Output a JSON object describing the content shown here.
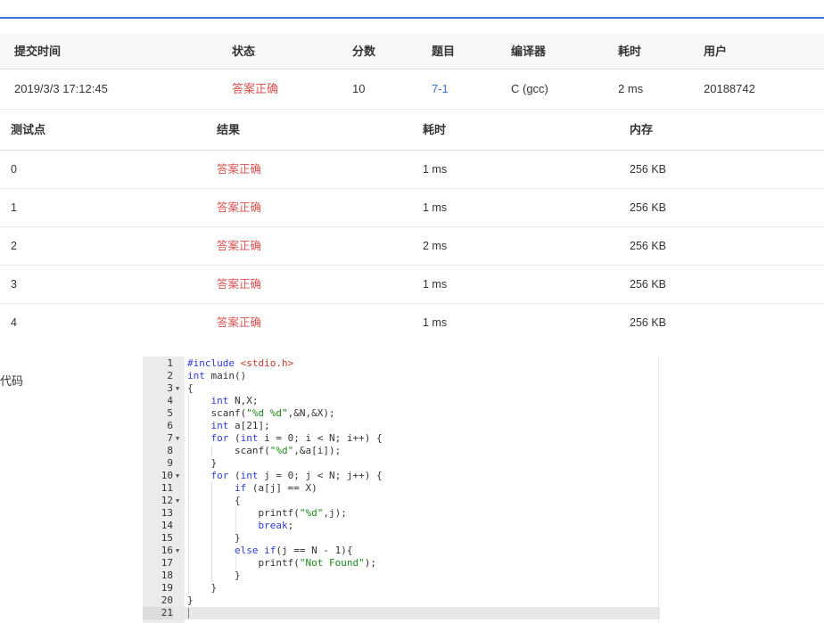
{
  "submission": {
    "headers": [
      "提交时间",
      "状态",
      "分数",
      "题目",
      "编译器",
      "耗时",
      "用户"
    ],
    "row": {
      "time": "2019/3/3 17:12:45",
      "status": "答案正确",
      "score": "10",
      "problem": "7-1",
      "compiler": "C (gcc)",
      "elapsed": "2 ms",
      "user": "20188742"
    }
  },
  "testcases": {
    "headers": [
      "测试点",
      "结果",
      "耗时",
      "内存"
    ],
    "rows": [
      {
        "id": "0",
        "result": "答案正确",
        "time": "1 ms",
        "memory": "256 KB"
      },
      {
        "id": "1",
        "result": "答案正确",
        "time": "1 ms",
        "memory": "256 KB"
      },
      {
        "id": "2",
        "result": "答案正确",
        "time": "2 ms",
        "memory": "256 KB"
      },
      {
        "id": "3",
        "result": "答案正确",
        "time": "1 ms",
        "memory": "256 KB"
      },
      {
        "id": "4",
        "result": "答案正确",
        "time": "1 ms",
        "memory": "256 KB"
      }
    ]
  },
  "code_section": {
    "label": "代码",
    "lines": [
      {
        "n": "1",
        "text": "#include <stdio.h>",
        "fold": false
      },
      {
        "n": "2",
        "text": "int main()",
        "fold": false
      },
      {
        "n": "3",
        "text": "{",
        "fold": true
      },
      {
        "n": "4",
        "text": "    int N,X;",
        "fold": false
      },
      {
        "n": "5",
        "text": "    scanf(\"%d %d\",&N,&X);",
        "fold": false
      },
      {
        "n": "6",
        "text": "    int a[21];",
        "fold": false
      },
      {
        "n": "7",
        "text": "    for (int i = 0; i < N; i++) {",
        "fold": true
      },
      {
        "n": "8",
        "text": "        scanf(\"%d\",&a[i]);",
        "fold": false
      },
      {
        "n": "9",
        "text": "    }",
        "fold": false
      },
      {
        "n": "10",
        "text": "    for (int j = 0; j < N; j++) {",
        "fold": true
      },
      {
        "n": "11",
        "text": "        if (a[j] == X)",
        "fold": false
      },
      {
        "n": "12",
        "text": "        {",
        "fold": true
      },
      {
        "n": "13",
        "text": "            printf(\"%d\",j);",
        "fold": false
      },
      {
        "n": "14",
        "text": "            break;",
        "fold": false
      },
      {
        "n": "15",
        "text": "        }",
        "fold": false
      },
      {
        "n": "16",
        "text": "        else if(j == N - 1){",
        "fold": true
      },
      {
        "n": "17",
        "text": "            printf(\"Not Found\");",
        "fold": false
      },
      {
        "n": "18",
        "text": "        }",
        "fold": false
      },
      {
        "n": "19",
        "text": "    }",
        "fold": false
      },
      {
        "n": "20",
        "text": "}",
        "fold": false
      },
      {
        "n": "21",
        "text": "",
        "fold": false
      }
    ]
  },
  "colors": {
    "accent": "#3b6fd6",
    "success_status": "#d9534f"
  },
  "icons": {
    "fold": "caret-down-icon"
  }
}
